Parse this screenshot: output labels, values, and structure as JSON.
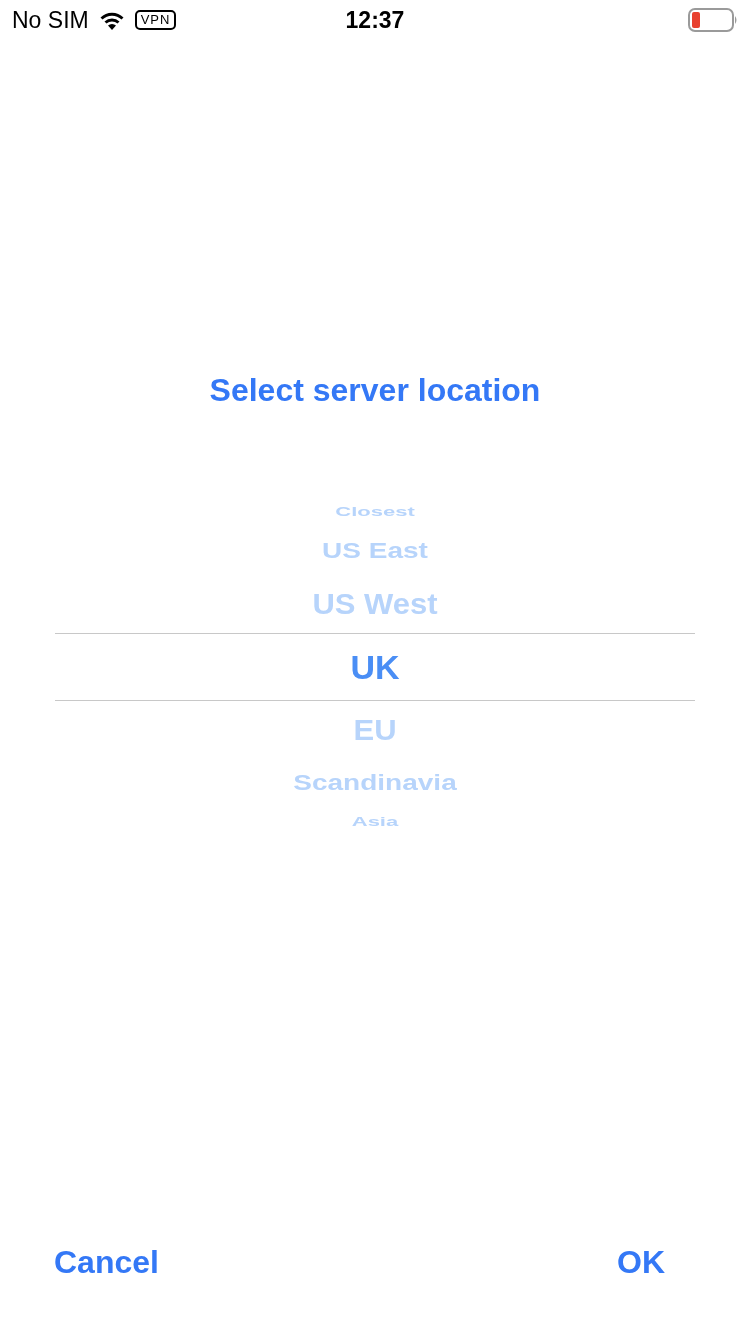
{
  "status_bar": {
    "carrier": "No SIM",
    "vpn": "VPN",
    "time": "12:37"
  },
  "title": "Select server location",
  "picker": {
    "items": [
      {
        "label": "Closest",
        "selected": false
      },
      {
        "label": "US East",
        "selected": false
      },
      {
        "label": "US West",
        "selected": false
      },
      {
        "label": "UK",
        "selected": true
      },
      {
        "label": "EU",
        "selected": false
      },
      {
        "label": "Scandinavia",
        "selected": false
      },
      {
        "label": "Asia",
        "selected": false
      }
    ]
  },
  "buttons": {
    "cancel": "Cancel",
    "ok": "OK"
  }
}
